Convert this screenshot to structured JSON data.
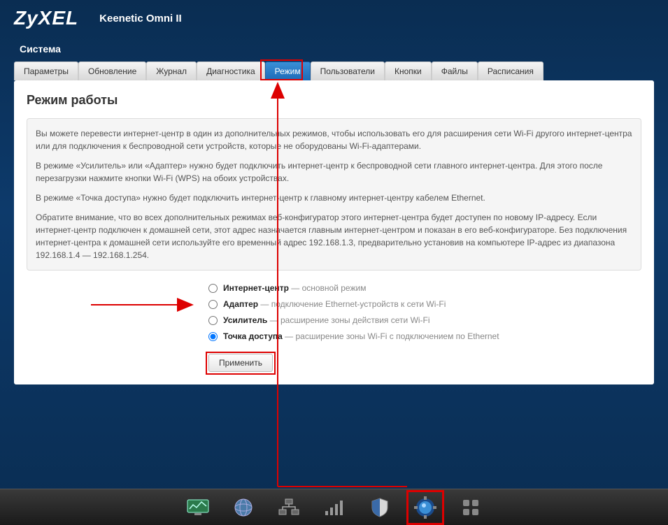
{
  "header": {
    "logo": "ZyXEL",
    "product": "Keenetic Omni II"
  },
  "section": "Система",
  "tabs": [
    {
      "label": "Параметры"
    },
    {
      "label": "Обновление"
    },
    {
      "label": "Журнал"
    },
    {
      "label": "Диагностика"
    },
    {
      "label": "Режим",
      "active": true
    },
    {
      "label": "Пользователи"
    },
    {
      "label": "Кнопки"
    },
    {
      "label": "Файлы"
    },
    {
      "label": "Расписания"
    }
  ],
  "panel": {
    "title": "Режим работы",
    "info": {
      "p1": "Вы можете перевести интернет-центр в один из дополнительных режимов, чтобы использовать его для расширения сети Wi-Fi другого интернет-центра или для подключения к беспроводной сети устройств, которые не оборудованы Wi-Fi-адаптерами.",
      "p2": "В режиме «Усилитель» или «Адаптер» нужно будет подключить интернет-центр к беспроводной сети главного интернет-центра. Для этого после перезагрузки нажмите кнопки Wi-Fi (WPS) на обоих устройствах.",
      "p3": "В режиме «Точка доступа» нужно будет подключить интернет-центр к главному интернет-центру кабелем Ethernet.",
      "p4": "Обратите внимание, что во всех дополнительных режимах веб-конфигуратор этого интернет-центра будет доступен по новому IP-адресу. Если интернет-центр подключен к домашней сети, этот адрес назначается главным интернет-центром и показан в его веб-конфигураторе. Без подключения интернет-центра к домашней сети используйте его временный адрес 192.168.1.3, предварительно установив на компьютере IP-адрес из диапазона 192.168.1.4 — 192.168.1.254."
    },
    "options": [
      {
        "main": "Интернет-центр",
        "sub": " — основной режим",
        "checked": false
      },
      {
        "main": "Адаптер",
        "sub": " — подключение Ethernet-устройств к сети Wi-Fi",
        "checked": false
      },
      {
        "main": "Усилитель",
        "sub": " — расширение зоны действия сети Wi-Fi",
        "checked": false
      },
      {
        "main": "Точка доступа",
        "sub": " — расширение зоны Wi-Fi с подключением по Ethernet",
        "checked": true
      }
    ],
    "apply": "Применить"
  },
  "bottomIcons": [
    "monitor-icon",
    "globe-icon",
    "network-icon",
    "signal-icon",
    "shield-icon",
    "gear-icon",
    "apps-icon"
  ]
}
